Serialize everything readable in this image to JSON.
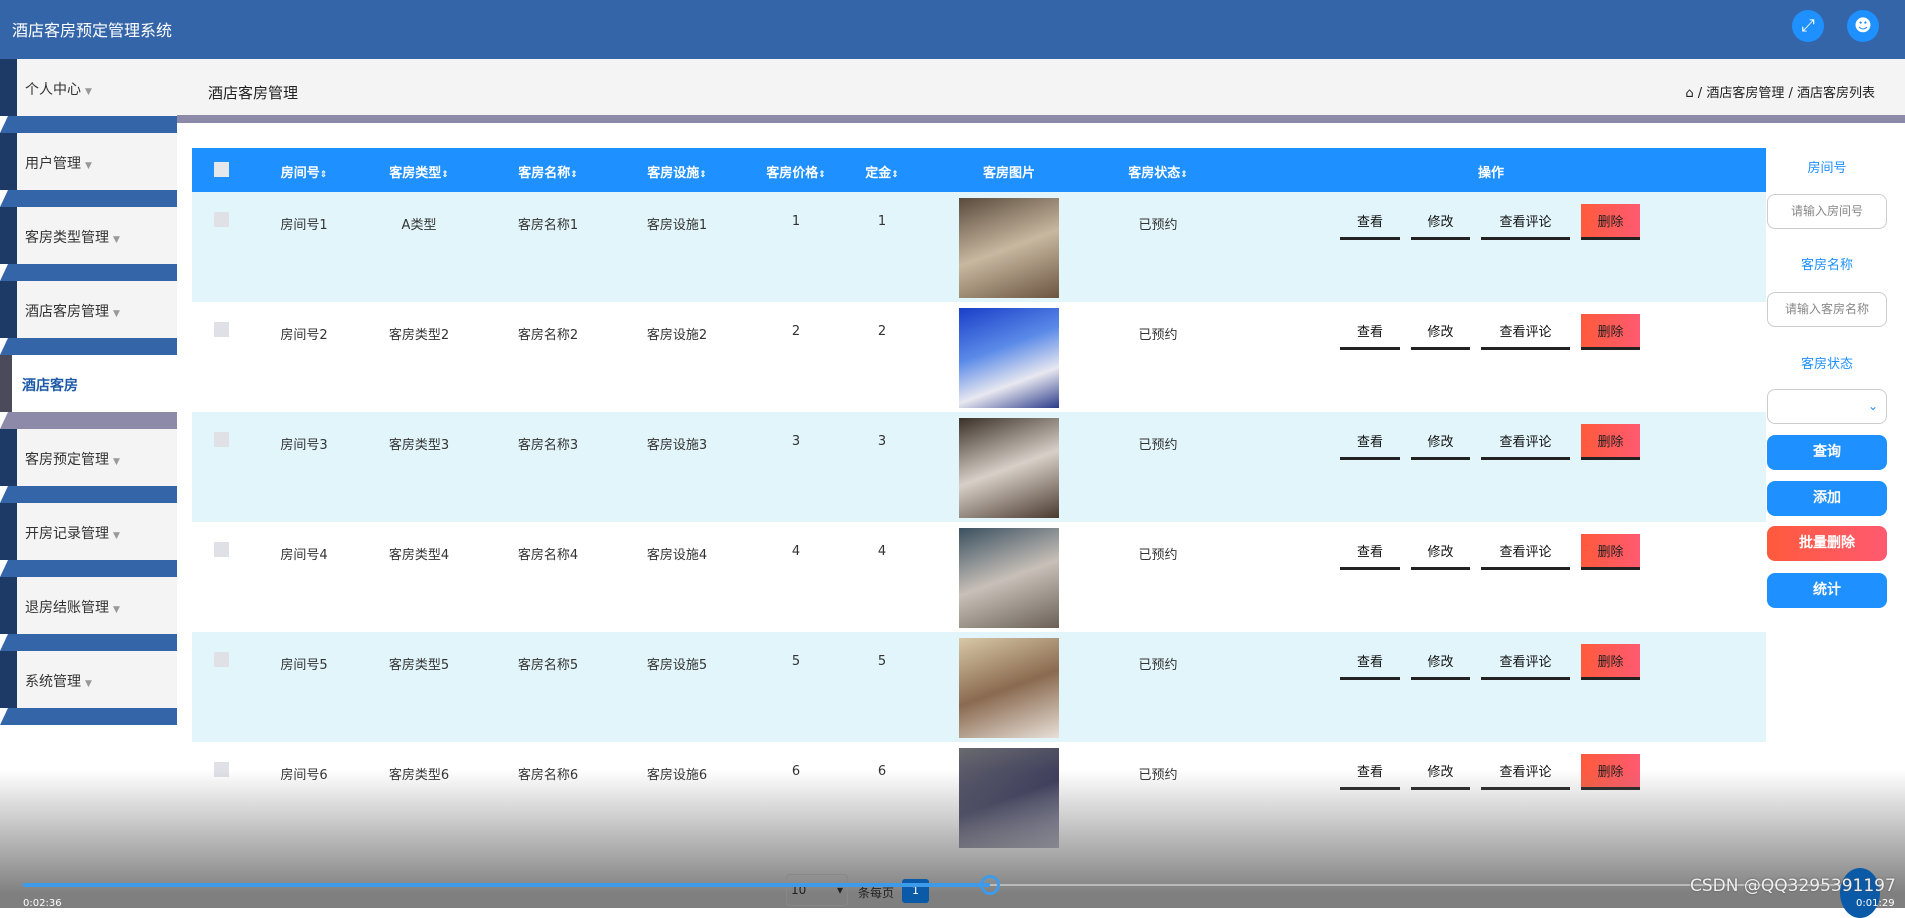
{
  "header": {
    "title": "酒店客房预定管理系统",
    "icons": [
      "fullscreen-icon",
      "user-icon"
    ],
    "color": "#3465a8"
  },
  "sidebar": {
    "items": [
      {
        "label": "个人中心"
      },
      {
        "label": "用户管理"
      },
      {
        "label": "客房类型管理"
      },
      {
        "label": "酒店客房管理"
      },
      {
        "label": "酒店客房",
        "active": true
      },
      {
        "label": "客房预定管理"
      },
      {
        "label": "开房记录管理"
      },
      {
        "label": "退房结账管理"
      },
      {
        "label": "系统管理"
      }
    ]
  },
  "page": {
    "title": "酒店客房管理",
    "breadcrumb": [
      "酒店客房管理",
      "酒店客房列表"
    ]
  },
  "table": {
    "columns": [
      "房间号",
      "客房类型",
      "客房名称",
      "客房设施",
      "客房价格",
      "定金",
      "客房图片",
      "客房状态",
      "操作"
    ],
    "actions": {
      "view": "查看",
      "edit": "修改",
      "comments": "查看评论",
      "delete": "删除"
    },
    "rows": [
      {
        "room": "房间号1",
        "type": "A类型",
        "name": "客房名称1",
        "facility": "客房设施1",
        "price": "1",
        "deposit": "1",
        "status": "已预约"
      },
      {
        "room": "房间号2",
        "type": "客房类型2",
        "name": "客房名称2",
        "facility": "客房设施2",
        "price": "2",
        "deposit": "2",
        "status": "已预约"
      },
      {
        "room": "房间号3",
        "type": "客房类型3",
        "name": "客房名称3",
        "facility": "客房设施3",
        "price": "3",
        "deposit": "3",
        "status": "已预约"
      },
      {
        "room": "房间号4",
        "type": "客房类型4",
        "name": "客房名称4",
        "facility": "客房设施4",
        "price": "4",
        "deposit": "4",
        "status": "已预约"
      },
      {
        "room": "房间号5",
        "type": "客房类型5",
        "name": "客房名称5",
        "facility": "客房设施5",
        "price": "5",
        "deposit": "5",
        "status": "已预约"
      },
      {
        "room": "房间号6",
        "type": "客房类型6",
        "name": "客房名称6",
        "facility": "客房设施6",
        "price": "6",
        "deposit": "6",
        "status": "已预约"
      }
    ]
  },
  "search": {
    "room_label": "房间号",
    "room_placeholder": "请输入房间号",
    "name_label": "客房名称",
    "name_placeholder": "请输入客房名称",
    "status_label": "客房状态",
    "status_value": "",
    "query": "查询",
    "add": "添加",
    "batch_delete": "批量删除",
    "stats": "统计"
  },
  "pager": {
    "page_size": "10",
    "per_page_text": "条每页",
    "current_page": "1"
  },
  "video": {
    "elapsed": "0:02:36",
    "remaining": "0:01:29",
    "progress": 0.52,
    "watermark": "CSDN @QQ3295391197"
  }
}
